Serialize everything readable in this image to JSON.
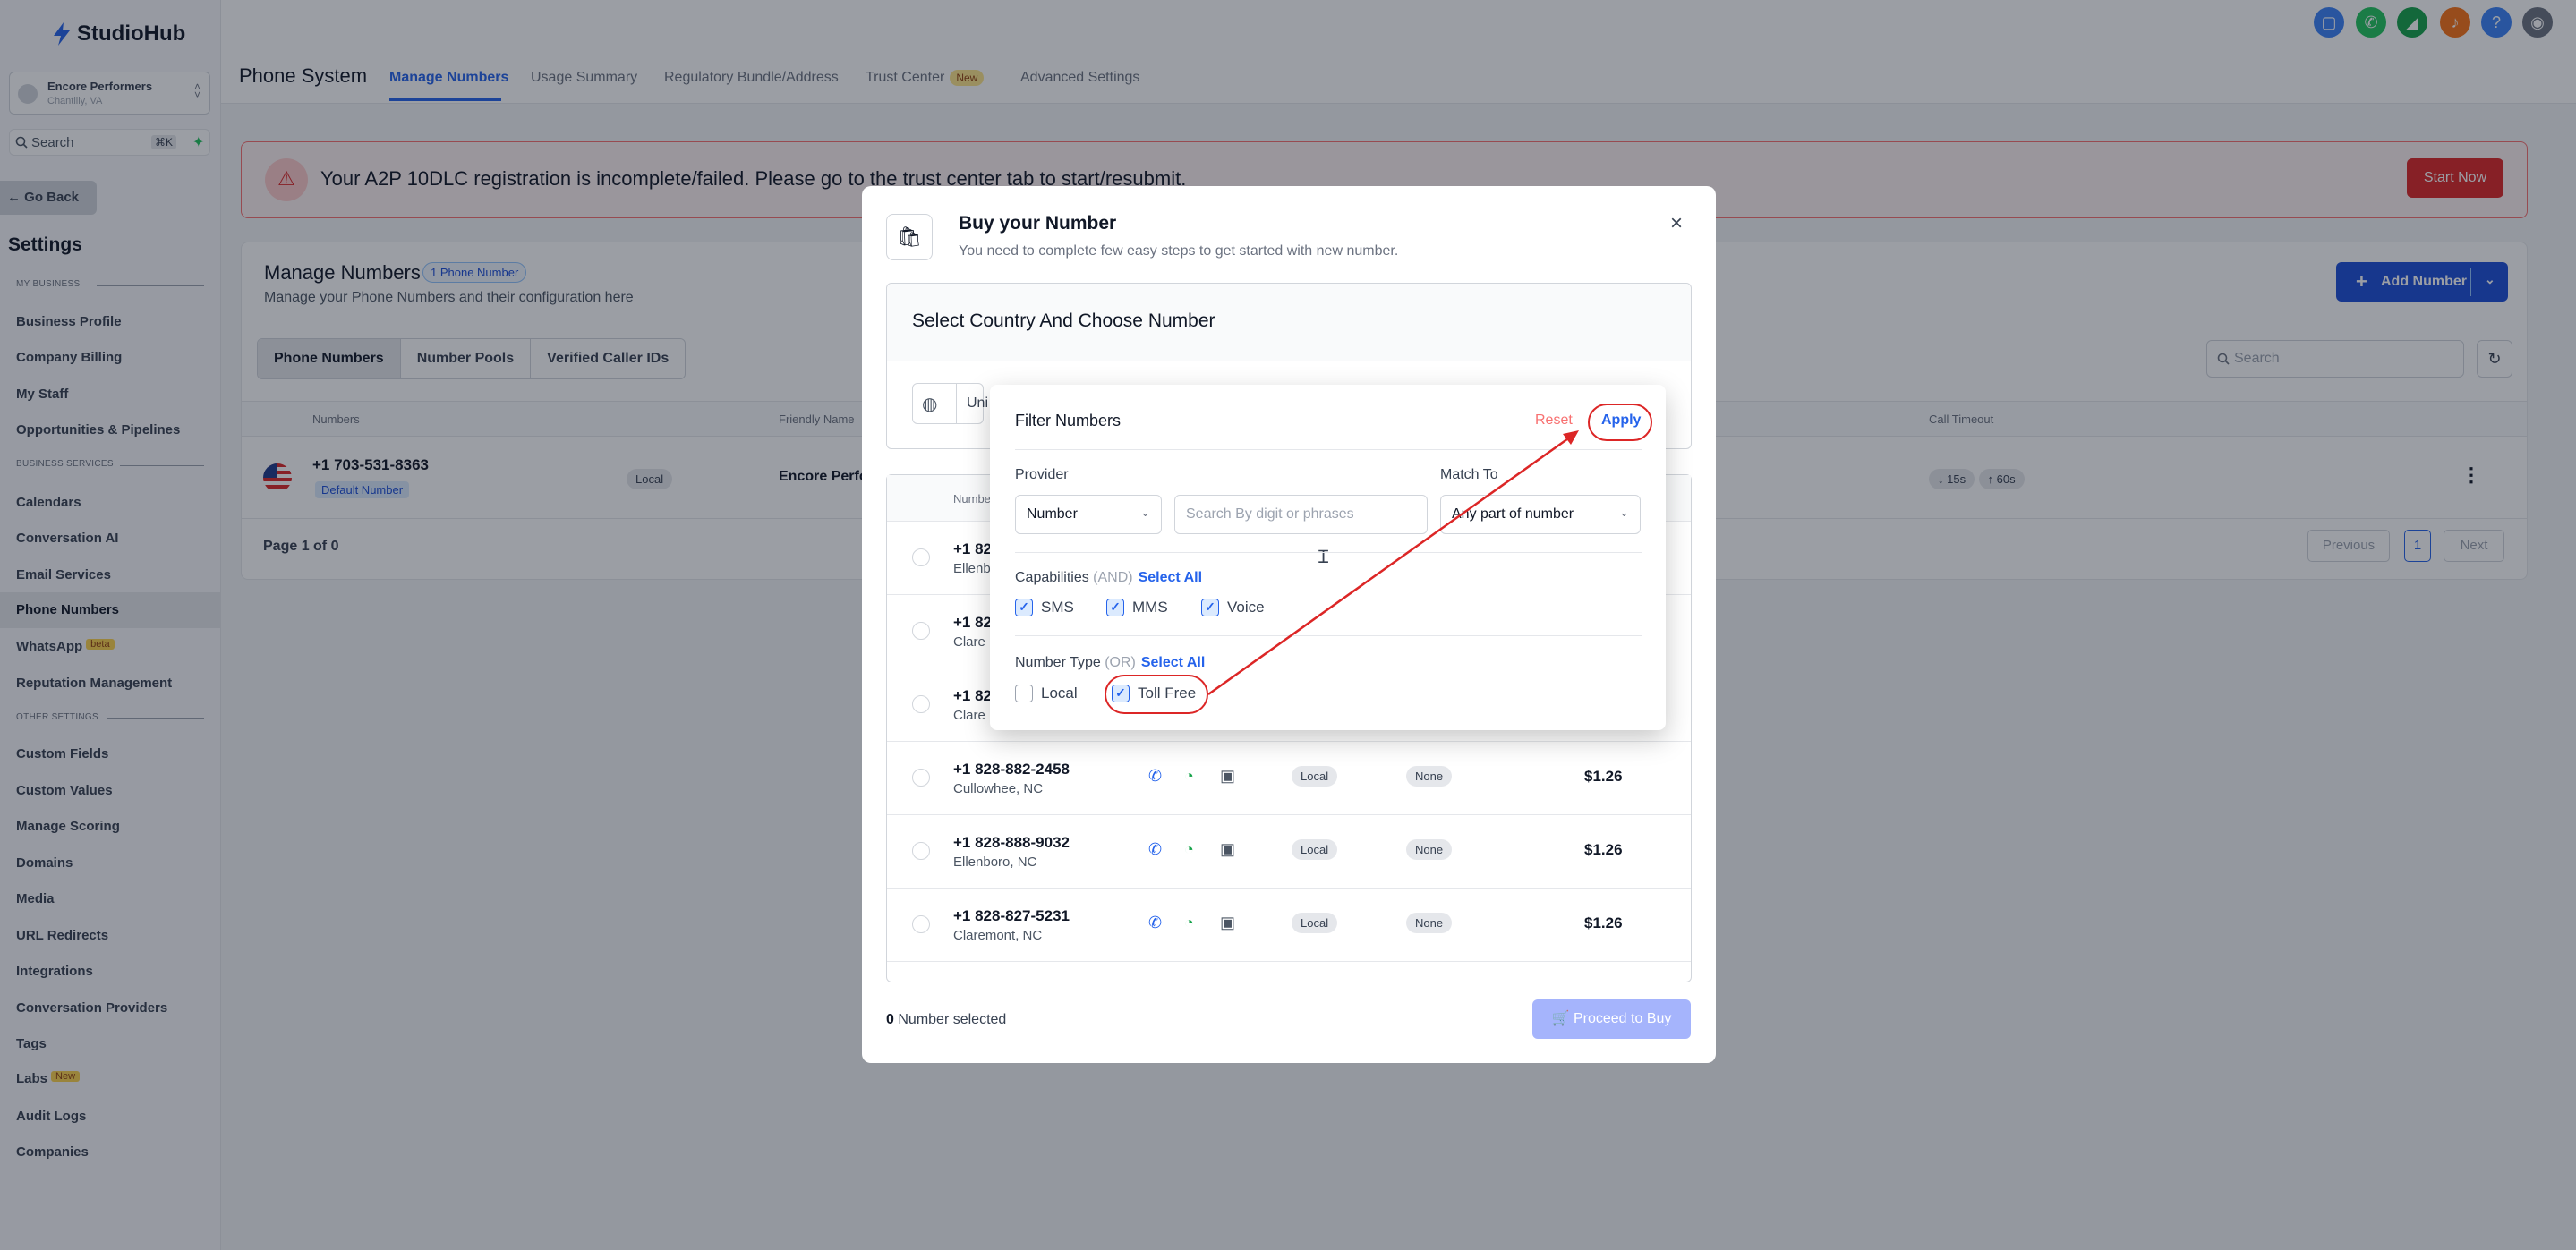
{
  "app": {
    "logo": "StudioHub"
  },
  "sidebar": {
    "location_name": "Encore Performers",
    "location_city": "Chantilly, VA",
    "search_label": "Search",
    "search_shortcut": "⌘K",
    "go_back": "Go Back",
    "settings_title": "Settings",
    "sections": {
      "my_business": "MY BUSINESS",
      "business_services": "BUSINESS SERVICES",
      "other_settings": "OTHER SETTINGS"
    },
    "items": {
      "business_profile": "Business Profile",
      "company_billing": "Company Billing",
      "my_staff": "My Staff",
      "opportunities": "Opportunities & Pipelines",
      "calendars": "Calendars",
      "conversation_ai": "Conversation AI",
      "email_services": "Email Services",
      "phone_numbers": "Phone Numbers",
      "whatsapp": "WhatsApp",
      "whatsapp_badge": "beta",
      "reputation": "Reputation Management",
      "custom_fields": "Custom Fields",
      "custom_values": "Custom Values",
      "manage_scoring": "Manage Scoring",
      "domains": "Domains",
      "media": "Media",
      "url_redirects": "URL Redirects",
      "integrations": "Integrations",
      "conversation_providers": "Conversation Providers",
      "tags": "Tags",
      "labs": "Labs",
      "labs_badge": "New",
      "audit_logs": "Audit Logs",
      "companies": "Companies"
    }
  },
  "header": {
    "title": "Phone System",
    "tabs": {
      "manage_numbers": "Manage Numbers",
      "usage_summary": "Usage Summary",
      "regulatory": "Regulatory Bundle/Address",
      "trust_center": "Trust Center",
      "trust_badge": "New",
      "advanced": "Advanced Settings"
    }
  },
  "alert": {
    "text": "Your A2P 10DLC registration is incomplete/failed. Please go to the trust center tab to start/resubmit.",
    "button": "Start Now"
  },
  "manage": {
    "title": "Manage Numbers",
    "count_badge": "1 Phone Number",
    "subtitle": "Manage your Phone Numbers and their configuration here",
    "add_button": "Add Number",
    "segments": {
      "phone_numbers": "Phone Numbers",
      "number_pools": "Number Pools",
      "verified_caller": "Verified Caller IDs"
    },
    "search_placeholder": "Search",
    "columns": {
      "numbers": "Numbers",
      "friendly_name": "Friendly Name",
      "call_timeout": "Call Timeout"
    },
    "row": {
      "number": "+1 703-531-8363",
      "default_badge": "Default Number",
      "type": "Local",
      "friendly": "Encore Perfo",
      "timeout_down": "↓ 15s",
      "timeout_up": "↑ 60s"
    },
    "page_text": "Page 1 of 0",
    "prev": "Previous",
    "page": "1",
    "next": "Next"
  },
  "modal": {
    "title": "Buy your Number",
    "subtitle": "You need to complete few easy steps to get started with new number.",
    "section_title": "Select Country And Choose Number",
    "country_value": "Uni",
    "list_header": "Numbe",
    "rows": [
      {
        "number": "+1 82",
        "city": "Ellenb"
      },
      {
        "number": "+1 82",
        "city": "Clare"
      },
      {
        "number": "+1 82",
        "city": "Clare"
      },
      {
        "number": "+1 828-882-2458",
        "city": "Cullowhee, NC",
        "type": "Local",
        "addr": "None",
        "price": "$1.26"
      },
      {
        "number": "+1 828-888-9032",
        "city": "Ellenboro, NC",
        "type": "Local",
        "addr": "None",
        "price": "$1.26"
      },
      {
        "number": "+1 828-827-5231",
        "city": "Claremont, NC",
        "type": "Local",
        "addr": "None",
        "price": "$1.26"
      }
    ],
    "selected_count": "0",
    "selected_label": "Number selected",
    "proceed": "Proceed to Buy"
  },
  "filter": {
    "title": "Filter Numbers",
    "reset": "Reset",
    "apply": "Apply",
    "provider_label": "Provider",
    "match_label": "Match To",
    "provider_value": "Number",
    "search_placeholder": "Search By digit or phrases",
    "match_value": "Any part of number",
    "capabilities_label": "Capabilities",
    "capabilities_mode": "(AND)",
    "select_all": "Select All",
    "caps": [
      {
        "label": "SMS",
        "checked": true
      },
      {
        "label": "MMS",
        "checked": true
      },
      {
        "label": "Voice",
        "checked": true
      }
    ],
    "type_label": "Number Type",
    "type_mode": "(OR)",
    "types": [
      {
        "label": "Local",
        "checked": false
      },
      {
        "label": "Toll Free",
        "checked": true
      }
    ]
  },
  "colors": {
    "accent": "#2563eb",
    "danger": "#dc2626",
    "annotation": "#dc2626"
  }
}
